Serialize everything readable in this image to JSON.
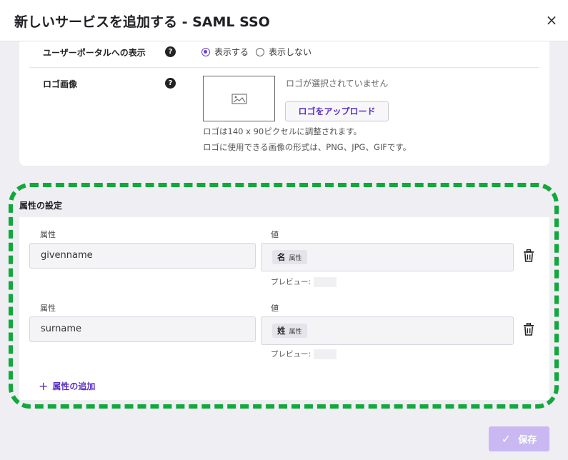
{
  "dialog": {
    "title": "新しいサービスを追加する - SAML SSO",
    "close_glyph": "×"
  },
  "portal_display": {
    "label": "ユーザーポータルへの表示",
    "help": "?",
    "options": [
      "表示する",
      "表示しない"
    ],
    "selected": "表示する"
  },
  "logo": {
    "label": "ロゴ画像",
    "help": "?",
    "empty_text": "ロゴが選択されていません",
    "upload_label": "ロゴをアップロード",
    "hint1": "ロゴは140 x 90ピクセルに調整されます。",
    "hint2": "ロゴに使用できる画像の形式は、PNG、JPG、GIFです。"
  },
  "attributes": {
    "section_title": "属性の設定",
    "attr_col_label": "属性",
    "value_col_label": "値",
    "preview_label": "プレビュー:",
    "rows": [
      {
        "attribute": "givenname",
        "chip_main": "名",
        "chip_sub": "属性"
      },
      {
        "attribute": "surname",
        "chip_main": "姓",
        "chip_sub": "属性"
      }
    ],
    "add_label": "属性の追加",
    "add_glyph": "+"
  },
  "footer": {
    "save_label": "保存",
    "check_glyph": "✓"
  },
  "colors": {
    "accent": "#5b2fc2",
    "highlight": "#11a83c",
    "save_disabled": "#c9b8f2"
  }
}
